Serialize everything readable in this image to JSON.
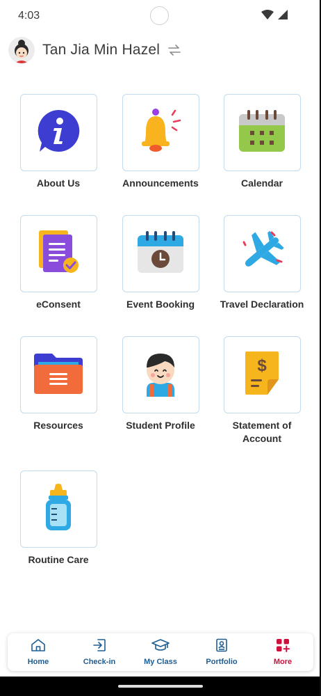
{
  "status_bar": {
    "time": "4:03"
  },
  "header": {
    "username": "Tan Jia Min Hazel"
  },
  "tiles": [
    {
      "label": "About Us"
    },
    {
      "label": "Announcements"
    },
    {
      "label": "Calendar"
    },
    {
      "label": "eConsent"
    },
    {
      "label": "Event Booking"
    },
    {
      "label": "Travel Declaration"
    },
    {
      "label": "Resources"
    },
    {
      "label": "Student Profile"
    },
    {
      "label": "Statement of Account"
    },
    {
      "label": "Routine Care"
    }
  ],
  "bottom_nav": {
    "items": [
      {
        "label": "Home",
        "icon": "home-icon"
      },
      {
        "label": "Check-in",
        "icon": "check-in-icon"
      },
      {
        "label": "My Class",
        "icon": "graduation-cap-icon"
      },
      {
        "label": "Portfolio",
        "icon": "portfolio-icon"
      },
      {
        "label": "More",
        "icon": "more-grid-icon"
      }
    ],
    "active": "More"
  },
  "colors": {
    "nav_text": "#1e5d92",
    "active": "#d10f3d",
    "tile_border": "#c3dbee"
  }
}
